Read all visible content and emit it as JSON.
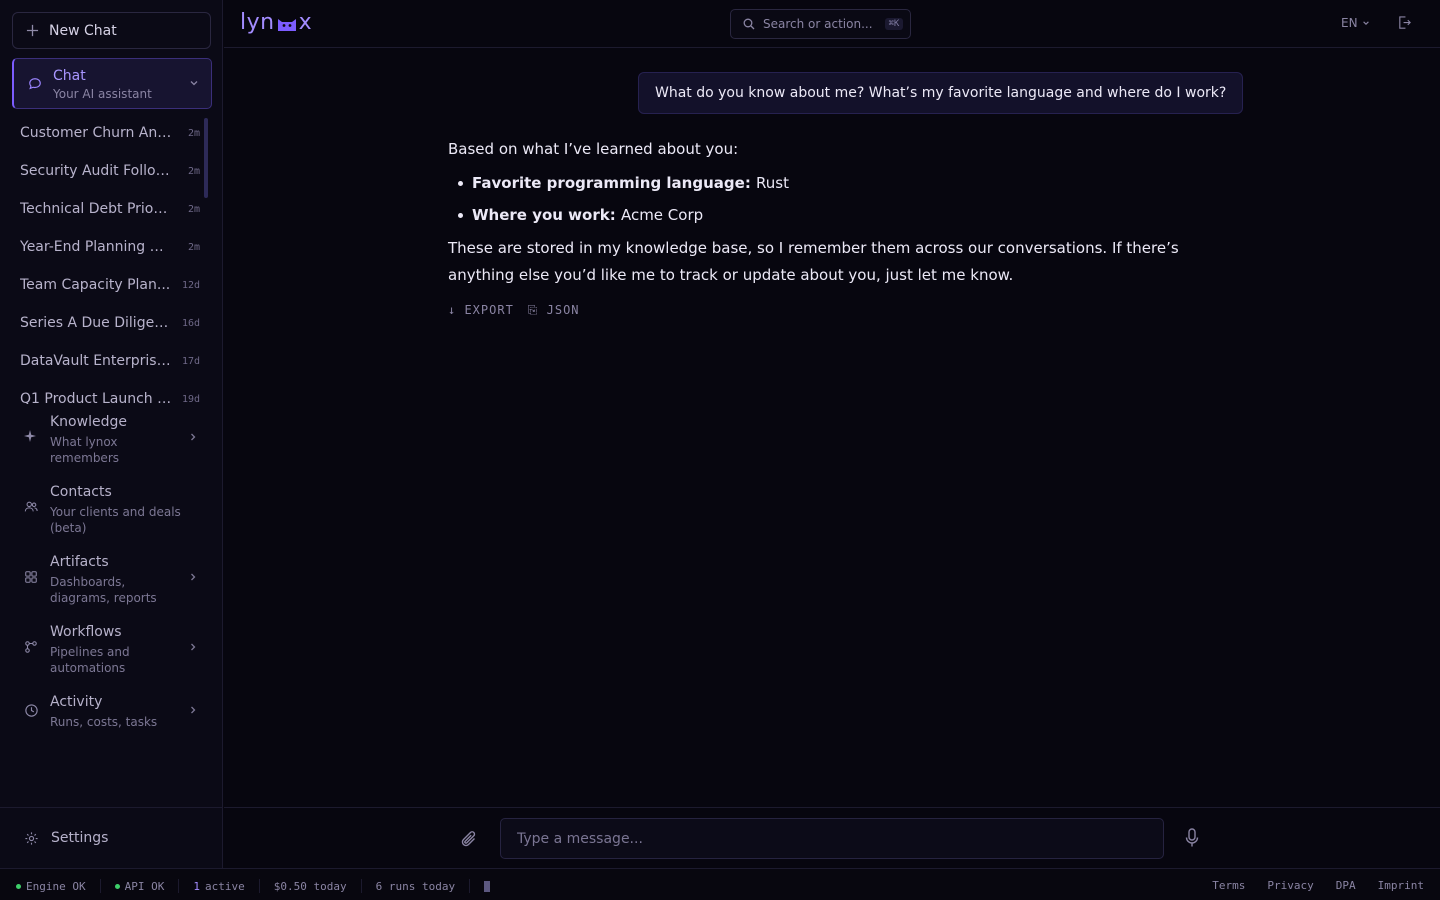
{
  "sidebar": {
    "new_chat_label": "New Chat",
    "active_nav": {
      "title": "Chat",
      "subtitle": "Your AI assistant"
    },
    "history": [
      {
        "title": "Customer Churn Anal...",
        "age": "2m"
      },
      {
        "title": "Security Audit Follow...",
        "age": "2m"
      },
      {
        "title": "Technical Debt Priori...",
        "age": "2m"
      },
      {
        "title": "Year-End Planning Se...",
        "age": "2m"
      },
      {
        "title": "Team Capacity Plan...",
        "age": "12d"
      },
      {
        "title": "Series A Due Diligen...",
        "age": "16d"
      },
      {
        "title": "DataVault Enterprise...",
        "age": "17d"
      },
      {
        "title": "Q1 Product Launch P...",
        "age": "19d"
      }
    ],
    "nav": [
      {
        "title": "Knowledge",
        "subtitle": "What lynox remembers",
        "icon": "sparkle-icon"
      },
      {
        "title": "Contacts",
        "subtitle": "Your clients and deals (beta)",
        "icon": "users-icon"
      },
      {
        "title": "Artifacts",
        "subtitle": "Dashboards, diagrams, reports",
        "icon": "grid-icon"
      },
      {
        "title": "Workflows",
        "subtitle": "Pipelines and automations",
        "icon": "workflow-icon"
      },
      {
        "title": "Activity",
        "subtitle": "Runs, costs, tasks",
        "icon": "clock-icon"
      }
    ],
    "settings_label": "Settings"
  },
  "topbar": {
    "logo": {
      "left": "lyn",
      "right": "x"
    },
    "search_placeholder": "Search or action...",
    "search_shortcut": "⌘K",
    "language": "EN"
  },
  "chat": {
    "user_message": "What do you know about me? What’s my favorite language and where do I work?",
    "assistant": {
      "intro": "Based on what I’ve learned about you:",
      "items": [
        {
          "label": "Favorite programming language",
          "value": "Rust"
        },
        {
          "label": "Where you work",
          "value": "Acme Corp"
        }
      ],
      "outro": "These are stored in my knowledge base, so I remember them across our conversations. If there’s anything else you’d like me to track or update about you, just let me know."
    },
    "actions": {
      "export": "↓ EXPORT",
      "json": "⎘ JSON"
    }
  },
  "composer": {
    "placeholder": "Type a message..."
  },
  "statusbar": {
    "engine": "Engine OK",
    "api": "API OK",
    "active_count": "1",
    "active_label": "active",
    "cost": "$0.50 today",
    "runs": "6 runs today",
    "links": [
      "Terms",
      "Privacy",
      "DPA",
      "Imprint"
    ]
  },
  "colors": {
    "accent": "#7c5cff",
    "ok": "#3ecf6a",
    "background": "#07060f"
  }
}
